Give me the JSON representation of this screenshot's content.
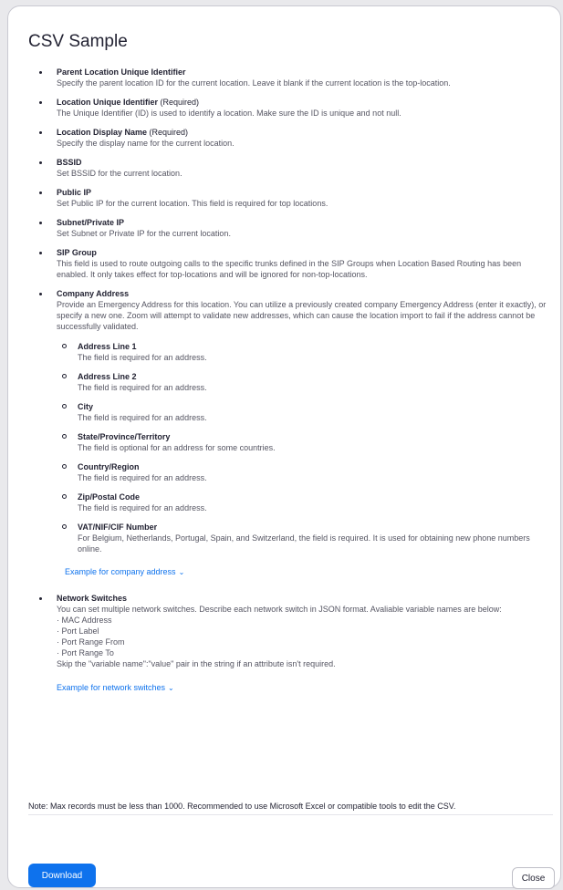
{
  "dialog": {
    "title": "CSV Sample"
  },
  "items": [
    {
      "label": "Parent Location Unique Identifier",
      "req": "",
      "desc": "Specify the parent location ID for the current location. Leave it blank if the current location is the top-location."
    },
    {
      "label": "Location Unique Identifier",
      "req": " (Required)",
      "desc": "The Unique Identifier (ID) is used to identify a location. Make sure the ID is unique and not null."
    },
    {
      "label": "Location Display Name",
      "req": " (Required)",
      "desc": "Specify the display name for the current location."
    },
    {
      "label": "BSSID",
      "req": "",
      "desc": "Set BSSID for the current location."
    },
    {
      "label": "Public IP",
      "req": "",
      "desc": "Set Public IP for the current location. This field is required for top locations."
    },
    {
      "label": "Subnet/Private IP",
      "req": "",
      "desc": "Set Subnet or Private IP for the current location."
    },
    {
      "label": "SIP Group",
      "req": "",
      "desc": "This field is used to route outgoing calls to the specific trunks defined in the SIP Groups when Location Based Routing has been enabled. It only takes effect for top-locations and will be ignored for non-top-locations."
    },
    {
      "label": "Company Address",
      "req": "",
      "desc": "Provide an Emergency Address for this location. You can utilize a previously created company Emergency Address (enter it exactly), or specify a new one. Zoom will attempt to validate new addresses, which can cause the location import to fail if the address cannot be successfully validated."
    },
    {
      "label": "Network Switches",
      "req": "",
      "desc": "You can set multiple network switches. Describe each network switch in JSON format. Avaliable variable names are below:"
    }
  ],
  "address_fields": [
    {
      "label": "Address Line 1",
      "desc": "The field is required for an address."
    },
    {
      "label": "Address Line 2",
      "desc": "The field is required for an address."
    },
    {
      "label": "City",
      "desc": "The field is required for an address."
    },
    {
      "label": "State/Province/Territory",
      "desc": "The field is optional for an address for some countries."
    },
    {
      "label": "Country/Region",
      "desc": "The field is required for an address."
    },
    {
      "label": "Zip/Postal Code",
      "desc": "The field is required for an address."
    },
    {
      "label": "VAT/NIF/CIF Number",
      "desc": "For Belgium, Netherlands, Portugal, Spain, and Switzerland, the field is required. It is used for obtaining new phone numbers online."
    }
  ],
  "company_address_example_link": "Example for company address",
  "network_switch_vars": [
    "· MAC Address",
    "· Port Label",
    "· Port Range From",
    "· Port Range To"
  ],
  "network_switch_skip_note": "Skip the \"variable name\":\"value\" pair in the string if an attribute isn't required.",
  "network_switches_example_link": "Example for network switches",
  "note": {
    "prefix": "Note",
    "text": ": Max records must be less than 1000. Recommended to use Microsoft Excel or compatible tools to edit the CSV."
  },
  "buttons": {
    "download": "Download",
    "close": "Close"
  },
  "colors": {
    "accent": "#0e72ed",
    "text": "#232333",
    "muted": "#555562"
  },
  "icons": {
    "chevron": "chevron-down-icon"
  }
}
